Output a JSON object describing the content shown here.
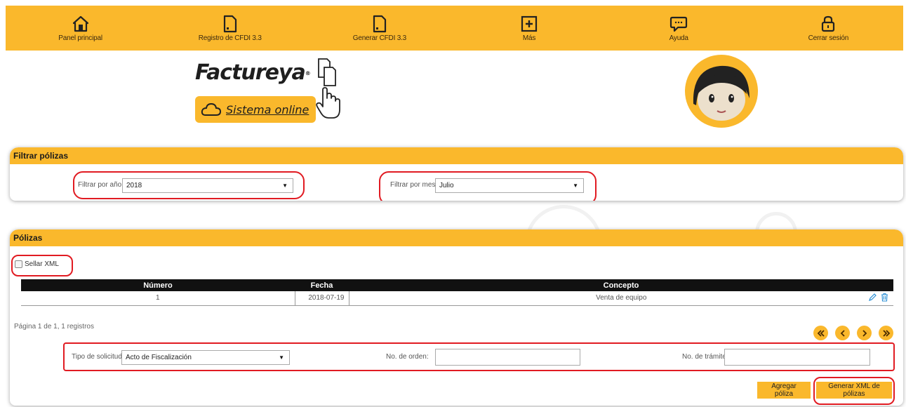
{
  "nav": {
    "items": [
      {
        "label": "Panel principal",
        "icon": "home-icon"
      },
      {
        "label": "Registro de CFDI 3.3",
        "icon": "document-icon"
      },
      {
        "label": "Generar CFDI 3.3",
        "icon": "document-icon"
      },
      {
        "label": "Más",
        "icon": "plus-box-icon"
      },
      {
        "label": "Ayuda",
        "icon": "chat-bubble-icon"
      },
      {
        "label": "Cerrar sesión",
        "icon": "lock-icon"
      }
    ]
  },
  "branding": {
    "logo_text": "Factureya",
    "logo_mark": "®",
    "tagline": "Sistema online"
  },
  "filter": {
    "title": "Filtrar pólizas",
    "year_label": "Filtrar por año:",
    "year_value": "2018",
    "month_label": "Filtrar por mes:",
    "month_value": "Julio"
  },
  "polizas": {
    "title": "Pólizas",
    "seal_label": "Sellar XML",
    "seal_checked": false,
    "columns": [
      "Número",
      "Fecha",
      "Concepto"
    ],
    "rows": [
      {
        "numero": "1",
        "fecha": "2018-07-19",
        "concepto": "Venta de equipo"
      }
    ],
    "page_info": "Página 1 de 1, 1 registros",
    "solicitud_label": "Tipo de solicitud:",
    "solicitud_value": "Acto de Fiscalización",
    "orden_label": "No. de orden:",
    "orden_value": "",
    "tramite_label": "No. de trámite:",
    "tramite_value": "",
    "add_button": "Agregar póliza",
    "generate_button": "Generar XML de pólizas"
  },
  "colors": {
    "accent": "#fab82c",
    "highlight": "#e11b22",
    "table_header": "#111111"
  }
}
